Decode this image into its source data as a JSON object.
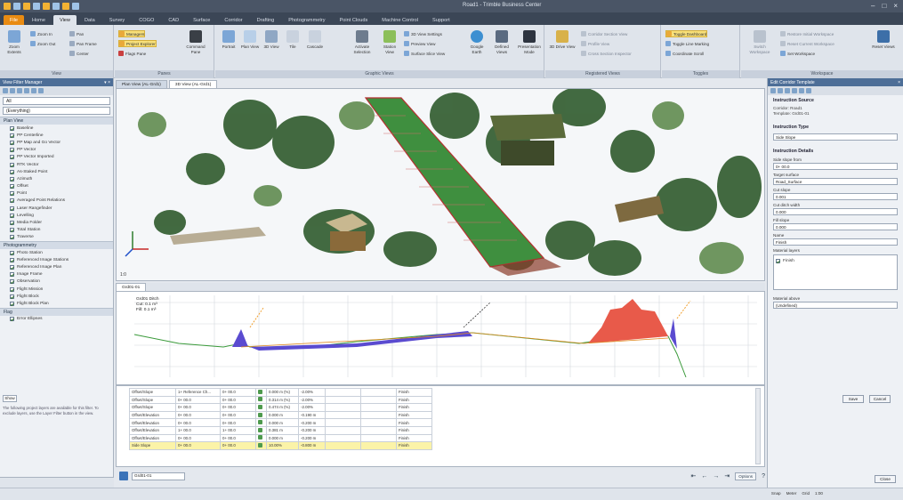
{
  "window": {
    "title": "Road1 - Trimble Business Center"
  },
  "ribbon": {
    "tabs": [
      "File",
      "Home",
      "View",
      "Data",
      "Survey",
      "COGO",
      "CAD",
      "Surface",
      "Corridor",
      "Drafting",
      "Photogrammetry",
      "Point Clouds",
      "Machine Control",
      "Support"
    ],
    "active_tab": "View",
    "groups": [
      {
        "label": "View",
        "buttons": [
          "Zoom Extents",
          "Zoom In",
          "Zoom Out",
          "Pan",
          "Pan Frame",
          "Center"
        ]
      },
      {
        "label": "Panes",
        "buttons": [
          "Managers",
          "Project Explorer",
          "Flags Pane",
          "Command Pane"
        ]
      },
      {
        "label": "Graphic Views",
        "buttons": [
          "Portrait",
          "Plan View",
          "3D View",
          "Tile",
          "Cascade",
          "Activate Selection",
          "Station View",
          "3D View Settings",
          "Preview View",
          "Surface Slice View",
          "Google Earth",
          "Defined Views",
          "Presentation Mode"
        ]
      },
      {
        "label": "Registered Views",
        "buttons": [
          "3D Drive View",
          "Corridor Section View",
          "Profile View",
          "Cross Section Inspector"
        ]
      },
      {
        "label": "Toggles",
        "buttons": [
          "Toggle Dashboard",
          "Toggle Line Marking",
          "Coordinate Scroll"
        ]
      },
      {
        "label": "Workspace",
        "buttons": [
          "Switch Workspace",
          "Restore Initial Workspace",
          "Reset Current Workspace",
          "Set Workspace",
          "Reset Views"
        ]
      }
    ]
  },
  "left_panel": {
    "title": "View Filter Manager",
    "combo": "(Everything)",
    "filter": "All",
    "sections": [
      {
        "title": "Plan View",
        "items": [
          "Baseline",
          "PP Centerline",
          "PP Map and Go Vector",
          "PP Vector",
          "PP Vector Imported",
          "RTK Vector",
          "As-Staked Point",
          "Azimuth",
          "Offset",
          "Point",
          "Averaged Point Relations",
          "Laser Rangefinder",
          "Levelling",
          "Media Folder",
          "Total Station",
          "Traverse"
        ]
      },
      {
        "title": "Photogrammetry",
        "items": [
          "Photo Station",
          "Referenced Image Stations",
          "Referenced Image Plan",
          "Image Frame",
          "Observation",
          "Flight Mission",
          "Flight Block",
          "Flight Block Plan"
        ]
      },
      {
        "title": "Flag",
        "items": [
          "Error Ellipses"
        ]
      }
    ],
    "note": "The following project layers are available for this filter. To exclude layers, use the Layer Filter button in the view.",
    "note_button": "Show",
    "bottom_buttons": [
      "Project Explorer",
      "View Filter Manager"
    ]
  },
  "main": {
    "doc_tabs": [
      "Plan View (AL-Grd1)",
      "3D View (AL-Grd1)"
    ],
    "scale": "1:0",
    "profile_tab": "Grd01-01",
    "profile_info": [
      "Grd01 Ditch",
      "Cut: 0.1 m³",
      "Fill: 0.1 m³"
    ],
    "table_rows": [
      [
        "Offset/Slope",
        "1+ Reference Ch...",
        "0+ 00.0",
        "0.000 m (%)",
        "-2.00%",
        "Finish"
      ],
      [
        "Offset/Slope",
        "0+ 00.0",
        "0+ 00.0",
        "0.314 m (%)",
        "-2.00%",
        "Finish"
      ],
      [
        "Offset/Slope",
        "0+ 00.0",
        "0+ 00.0",
        "0.474 m (%)",
        "-2.00%",
        "Finish"
      ],
      [
        "Offset/Elevation",
        "0+ 00.0",
        "0+ 00.0",
        "0.000 m",
        "-0.190 m",
        "Finish"
      ],
      [
        "Offset/Elevation",
        "0+ 00.0",
        "0+ 00.0",
        "0.000 m",
        "-0.200 m",
        "Finish"
      ],
      [
        "Offset/Elevation",
        "1+ 00.0",
        "1+ 00.0",
        "0.381 m",
        "-0.200 m",
        "Finish"
      ],
      [
        "Offset/Elevation",
        "0+ 00.0",
        "0+ 00.0",
        "0.000 m",
        "-0.200 m",
        "Finish"
      ],
      [
        "Side Slope",
        "0+ 00.0",
        "0+ 00.0",
        "10.00%",
        "-0.800 m",
        "Finish"
      ]
    ],
    "status_field": "Grd01-01",
    "status_options": "Options",
    "close_button": "Close"
  },
  "right_panel": {
    "title": "Edit Corridor Template",
    "sections": {
      "source": "Instruction Source",
      "source_text": [
        "Corridor: Road1",
        "Template: Grd01-01"
      ],
      "type": "Instruction Type",
      "type_value": "Side Slope",
      "details": "Instruction Details"
    },
    "fields": [
      {
        "label": "Side slope from",
        "value": "0+ 00.0"
      },
      {
        "label": "Target surface",
        "value": "Road_Surface"
      },
      {
        "label": "Cut slope",
        "value": "0.001"
      },
      {
        "label": "Cut ditch width",
        "value": "0.000"
      },
      {
        "label": "Fill slope",
        "value": "0.000"
      },
      {
        "label": "Name",
        "value": "Finish"
      }
    ],
    "layers_label": "Material layers",
    "layers": [
      "Finish"
    ],
    "above_label": "Material above",
    "above_value": "(Undefined)",
    "buttons": [
      "Save",
      "Cancel"
    ]
  },
  "status_bar": {
    "snap": "Snap",
    "meter": "Meter",
    "grid": "Grid",
    "coord": "1:00"
  },
  "colors": {
    "file_tab": "#e98b12",
    "panel_title": "#4d6e97",
    "cut": "#e85a4a",
    "fill": "#5a4bd0"
  }
}
